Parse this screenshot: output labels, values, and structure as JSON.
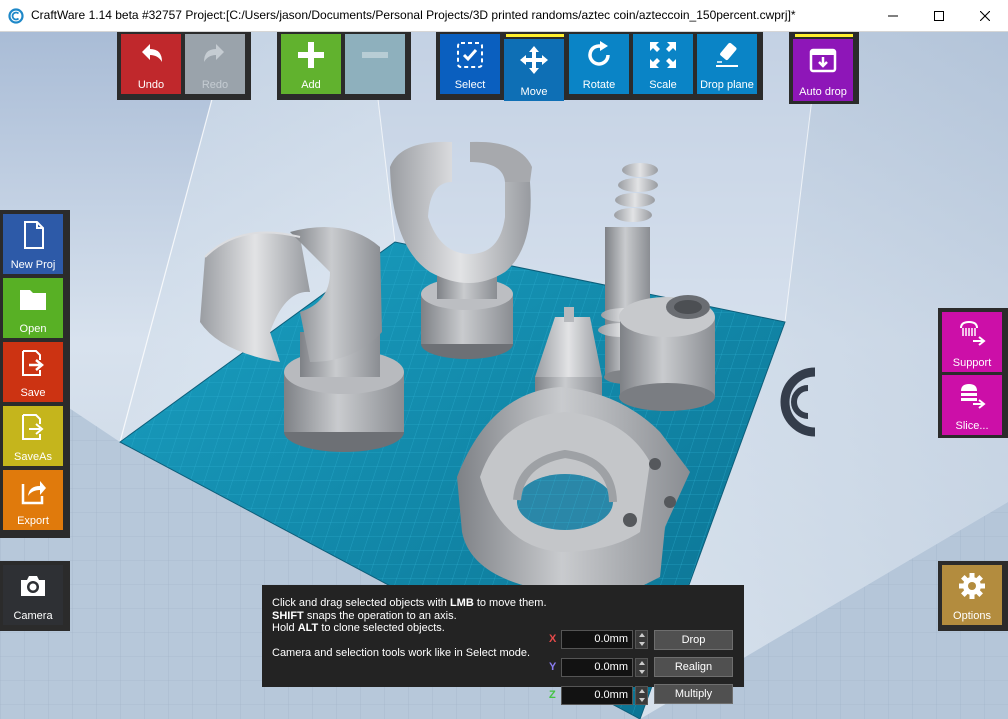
{
  "window": {
    "title": "CraftWare 1.14 beta #32757   Project:[C:/Users/jason/Documents/Personal Projects/3D printed randoms/aztec coin/azteccoin_150percent.cwprj]*"
  },
  "toolbar": {
    "undo": "Undo",
    "redo": "Redo",
    "add": "Add",
    "remove": "",
    "select": "Select",
    "move": "Move",
    "rotate": "Rotate",
    "scale": "Scale",
    "drop_plane": "Drop plane",
    "auto_drop": "Auto drop"
  },
  "sidebar": {
    "new_proj": "New Proj",
    "open": "Open",
    "save": "Save",
    "save_as": "SaveAs",
    "export": "Export",
    "camera": "Camera"
  },
  "right_panel": {
    "support": "Support",
    "slice": "Slice...",
    "options": "Options"
  },
  "hint": {
    "line1_a": "Click and drag selected objects with ",
    "line1_b": "LMB",
    "line1_c": " to move them.",
    "line2_a": "SHIFT",
    "line2_b": " snaps the operation to an axis.",
    "line3_a": "Hold ",
    "line3_b": "ALT",
    "line3_c": " to clone selected objects.",
    "line4": "Camera and selection tools work like in Select mode."
  },
  "transform": {
    "x_label": "X",
    "y_label": "Y",
    "z_label": "Z",
    "x_value": "0.0mm",
    "y_value": "0.0mm",
    "z_value": "0.0mm",
    "drop": "Drop",
    "realign": "Realign",
    "multiply": "Multiply"
  },
  "colors": {
    "undo": "#c0282c",
    "add": "#61b22e",
    "tool_blue": "#0a84c6",
    "move_active": "#0e6fb5",
    "auto_drop": "#8e16b8",
    "new_proj": "#2d5aa8",
    "open": "#58b025",
    "save": "#cc3312",
    "save_as": "#c5b51c",
    "export": "#e07a0c",
    "support": "#cc0fa8",
    "options": "#b38c3e",
    "accent_yellow": "#ffef2e"
  }
}
